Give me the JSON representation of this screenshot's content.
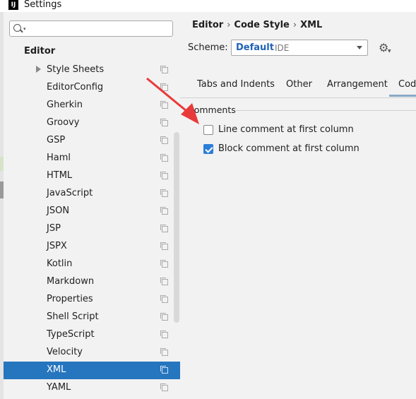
{
  "window": {
    "title": "Settings",
    "app_icon_glyph": "IJ"
  },
  "search": {
    "value": "",
    "placeholder": ""
  },
  "tree": {
    "section": "Editor",
    "items": [
      {
        "label": "Style Sheets",
        "expandable": true
      },
      {
        "label": "EditorConfig"
      },
      {
        "label": "Gherkin"
      },
      {
        "label": "Groovy"
      },
      {
        "label": "GSP"
      },
      {
        "label": "Haml"
      },
      {
        "label": "HTML"
      },
      {
        "label": "JavaScript"
      },
      {
        "label": "JSON"
      },
      {
        "label": "JSP"
      },
      {
        "label": "JSPX"
      },
      {
        "label": "Kotlin"
      },
      {
        "label": "Markdown"
      },
      {
        "label": "Properties"
      },
      {
        "label": "Shell Script"
      },
      {
        "label": "TypeScript"
      },
      {
        "label": "Velocity"
      },
      {
        "label": "XML",
        "selected": true
      },
      {
        "label": "YAML"
      }
    ]
  },
  "breadcrumb": [
    "Editor",
    "Code Style",
    "XML"
  ],
  "scheme": {
    "label": "Scheme:",
    "name": "Default",
    "sub": "IDE"
  },
  "tabs": [
    {
      "label": "Tabs and Indents"
    },
    {
      "label": "Other"
    },
    {
      "label": "Arrangement"
    },
    {
      "label": "Code",
      "active": true
    }
  ],
  "comments": {
    "title": "Comments",
    "options": [
      {
        "label": "Line comment at first column",
        "checked": false
      },
      {
        "label": "Block comment at first column",
        "checked": true
      }
    ]
  },
  "colors": {
    "selection": "#2675bf",
    "scheme_name": "#2063b8",
    "checkbox_checked": "#2d7ed8",
    "annotation_arrow": "#e83a3a"
  },
  "icons": [
    "search-icon",
    "chevron-right-icon",
    "copy-icon",
    "dropdown-icon",
    "gear-icon",
    "check-icon",
    "arrow-annotation"
  ]
}
